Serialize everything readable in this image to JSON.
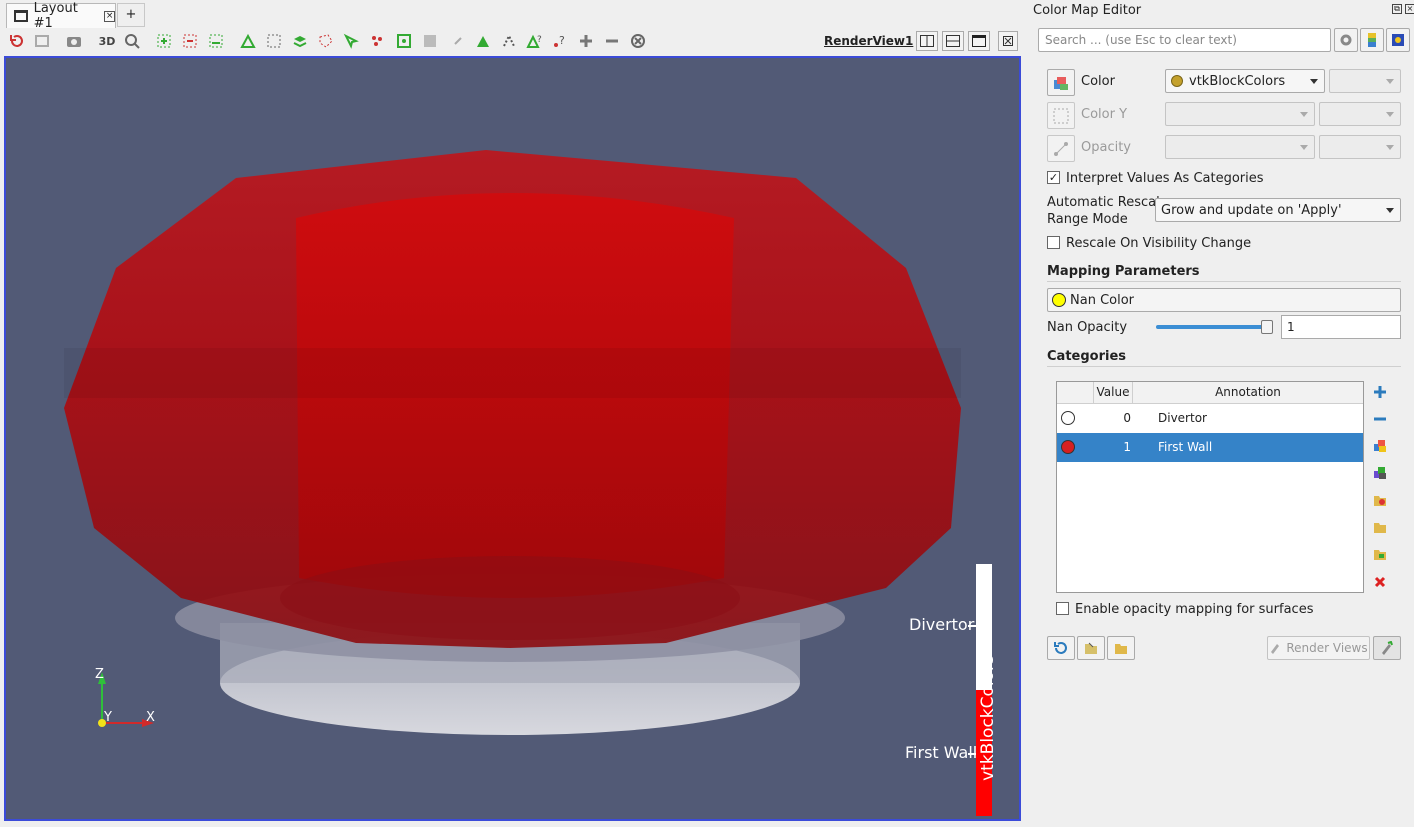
{
  "layout_tab": {
    "title": "Layout #1",
    "add_label": "+"
  },
  "toolbar": {
    "three_d_label": "3D",
    "render_view_label": "RenderView1"
  },
  "render_view": {
    "axes": {
      "z": "Z",
      "y": "Y",
      "x": "X"
    },
    "color_legend": {
      "title": "vtkBlockColors",
      "labels": [
        "Divertor",
        "First Wall"
      ],
      "colors": [
        "#ffffff",
        "#ff0000"
      ]
    },
    "colors": {
      "background": "#525a76",
      "wall": "#cc0a0a",
      "divertor": "#d9d9d9"
    }
  },
  "panel": {
    "title": "Color Map Editor",
    "search_placeholder": "Search ... (use Esc to clear text)",
    "color_label": "Color",
    "color_array": "vtkBlockColors",
    "color_y_label": "Color Y",
    "opacity_label": "Opacity",
    "interpret_categories_label": "Interpret Values As Categories",
    "interpret_categories_checked": true,
    "auto_rescale_label_1": "Automatic Rescale",
    "auto_rescale_label_2": "Range Mode",
    "auto_rescale_value": "Grow and update on 'Apply'",
    "rescale_visibility_label": "Rescale On Visibility Change",
    "mapping_params_title": "Mapping Parameters",
    "nan_color_label": "Nan Color",
    "nan_color": "#ffff00",
    "nan_opacity_label": "Nan Opacity",
    "nan_opacity_value": "1",
    "categories_title": "Categories",
    "table": {
      "headers": [
        "",
        "Value",
        "Annotation"
      ],
      "rows": [
        {
          "value": "0",
          "annotation": "Divertor",
          "color": "#ffffff",
          "selected": false
        },
        {
          "value": "1",
          "annotation": "First Wall",
          "color": "#d62020",
          "selected": true
        }
      ]
    },
    "opacity_mapping_label": "Enable opacity mapping for surfaces",
    "render_views_label": "Render Views",
    "accent": "#3583c8"
  }
}
